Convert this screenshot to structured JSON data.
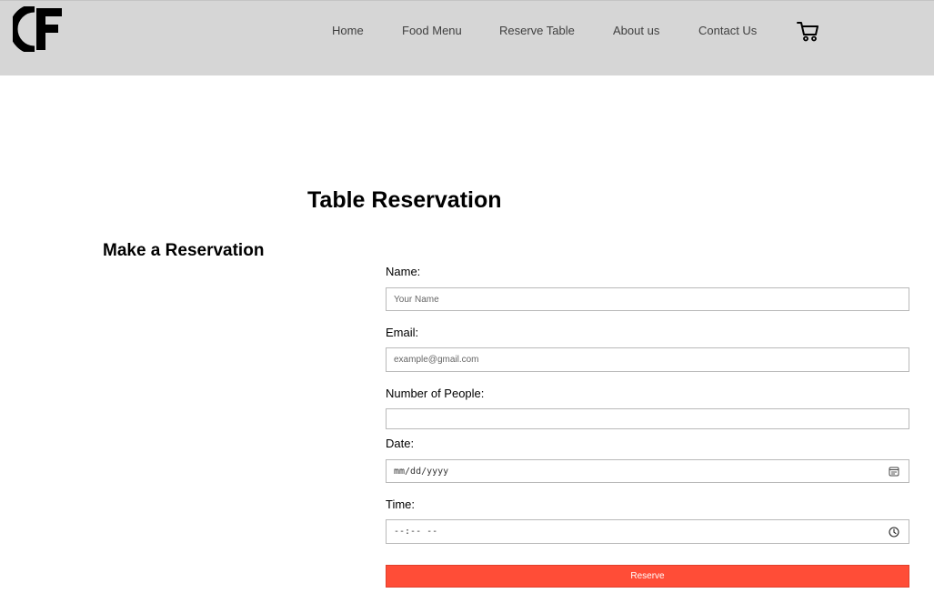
{
  "header": {
    "logo": "logo-icon",
    "nav": [
      "Home",
      "Food Menu",
      "Reserve Table",
      "About us",
      "Contact Us"
    ],
    "cart_icon": "shopping-cart-icon"
  },
  "page": {
    "title": "Table Reservation"
  },
  "form": {
    "section_title": "Make a Reservation",
    "name": {
      "label": "Name:",
      "placeholder": "Your Name"
    },
    "email": {
      "label": "Email:",
      "placeholder": "example@gmail.com"
    },
    "people": {
      "label": "Number of People:",
      "value": ""
    },
    "date": {
      "label": "Date:",
      "placeholder": "mm/dd/yyyy",
      "icon": "calendar-icon"
    },
    "time": {
      "label": "Time:",
      "placeholder": "--:-- --",
      "icon": "clock-icon"
    },
    "submit_label": "Reserve"
  },
  "colors": {
    "header_bg": "#d6d6d6",
    "accent": "#ff4d37"
  }
}
